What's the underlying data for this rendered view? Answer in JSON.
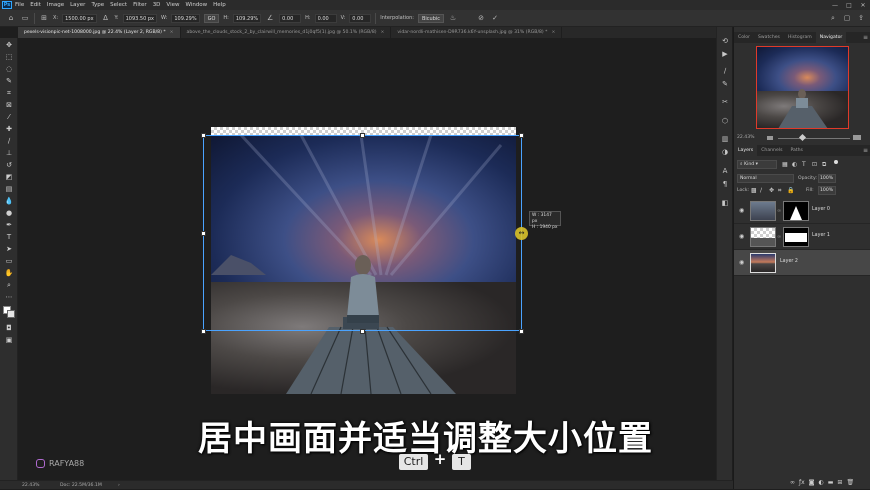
{
  "app": {
    "logo": "Ps"
  },
  "menu": [
    "File",
    "Edit",
    "Image",
    "Layer",
    "Type",
    "Select",
    "Filter",
    "3D",
    "View",
    "Window",
    "Help"
  ],
  "window_controls": [
    "—",
    "□",
    "✕"
  ],
  "options": {
    "x_label": "X:",
    "x_value": "1500.00 px",
    "y_label": "Y:",
    "y_value": "1093.50 px",
    "w_label": "W:",
    "w_value": "109.29%",
    "link_label": "GO",
    "h_label": "H:",
    "h_value": "109.29%",
    "angle_value": "0.00",
    "hskew_label": "H:",
    "hskew_value": "0.00",
    "vskew_label": "V:",
    "vskew_value": "0.00",
    "interp_label": "Interpolation:",
    "interp_value": "Bicubic"
  },
  "tabs": [
    {
      "label": "pexels-visionpic-net-1008000.jpg @ 22.4% (Layer 2, RGB/8) *",
      "active": true
    },
    {
      "label": "above_the_clouds_stock_2_by_clairwill_memories_d1j0qf5(1).jpg @ 50.1% (RGB/8)",
      "active": false
    },
    {
      "label": "vidar-nordli-mathisen-D9R736.k6Y-unsplash.jpg @ 31% (RGB/8) *",
      "active": false
    }
  ],
  "canvas": {
    "tooltip_w": "W : 3147 px",
    "tooltip_h": "H : 1940 px"
  },
  "subtitle": "居中画面并适当调整大小位置",
  "watermark": "RAFYA88",
  "keys": {
    "ctrl": "Ctrl",
    "plus": "+",
    "t": "T"
  },
  "status": {
    "zoom": "22.43%",
    "doc": "Doc: 22.5M/36.1M"
  },
  "panels": {
    "top_tabs": [
      "Color",
      "Swatches",
      "Histogram",
      "Navigator"
    ],
    "top_active": "Navigator",
    "nav_zoom": "22.43%",
    "layer_tabs": [
      "Layers",
      "Channels",
      "Paths"
    ],
    "layer_active": "Layers",
    "kind_label": "Kind",
    "blend_mode": "Normal",
    "opacity_label": "Opacity:",
    "opacity_value": "100%",
    "lock_label": "Lock:",
    "fill_label": "Fill:",
    "fill_value": "100%",
    "layers": [
      {
        "name": "Layer 0",
        "selected": false
      },
      {
        "name": "Layer 1",
        "selected": false
      },
      {
        "name": "Layer 2",
        "selected": true
      }
    ],
    "footer_icons": [
      "link-icon",
      "fx-icon",
      "mask-icon",
      "adjustment-icon",
      "group-icon",
      "new-layer-icon",
      "trash-icon"
    ]
  },
  "colors": {
    "accent": "#31a8ff",
    "selected_layer": "#474747",
    "panel": "#2f2f2f",
    "bg": "#1e1e1e"
  }
}
